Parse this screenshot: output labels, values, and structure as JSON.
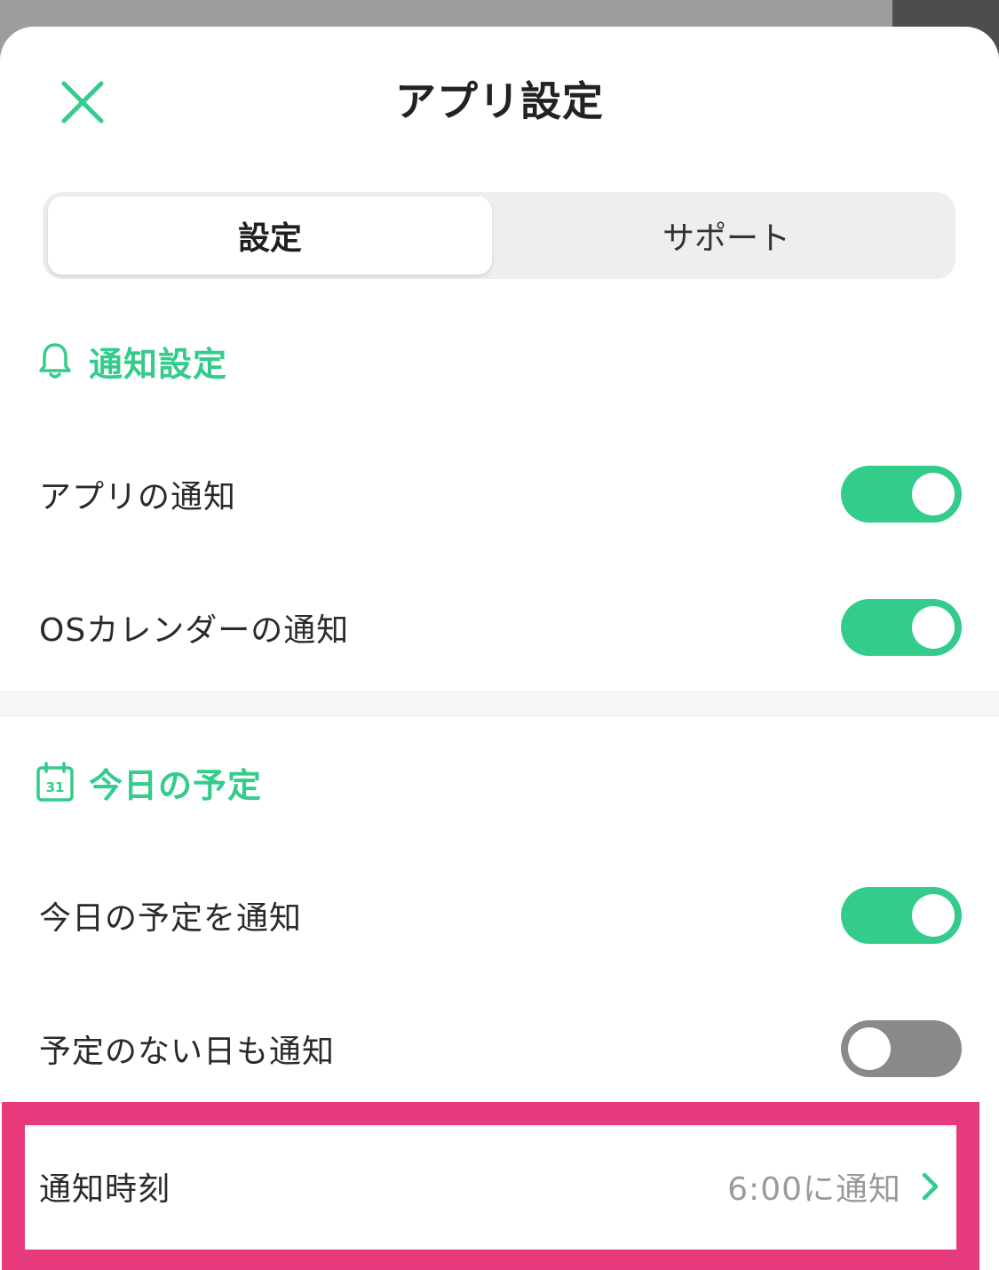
{
  "header": {
    "title": "アプリ設定"
  },
  "tabs": [
    {
      "label": "設定",
      "active": true
    },
    {
      "label": "サポート",
      "active": false
    }
  ],
  "sections": [
    {
      "title": "通知設定",
      "icon": "bell-icon",
      "rows": [
        {
          "label": "アプリの通知",
          "toggle": true
        },
        {
          "label": "OSカレンダーの通知",
          "toggle": true
        }
      ]
    },
    {
      "title": "今日の予定",
      "icon": "calendar-icon",
      "icon_text": "31",
      "rows": [
        {
          "label": "今日の予定を通知",
          "toggle": true
        },
        {
          "label": "予定のない日も通知",
          "toggle": false
        }
      ]
    }
  ],
  "notify_time": {
    "label": "通知時刻",
    "value": "6:00に通知"
  },
  "colors": {
    "accent": "#33cc8a",
    "toggle_off": "#8a8a8a",
    "highlight": "#e53a7b"
  }
}
